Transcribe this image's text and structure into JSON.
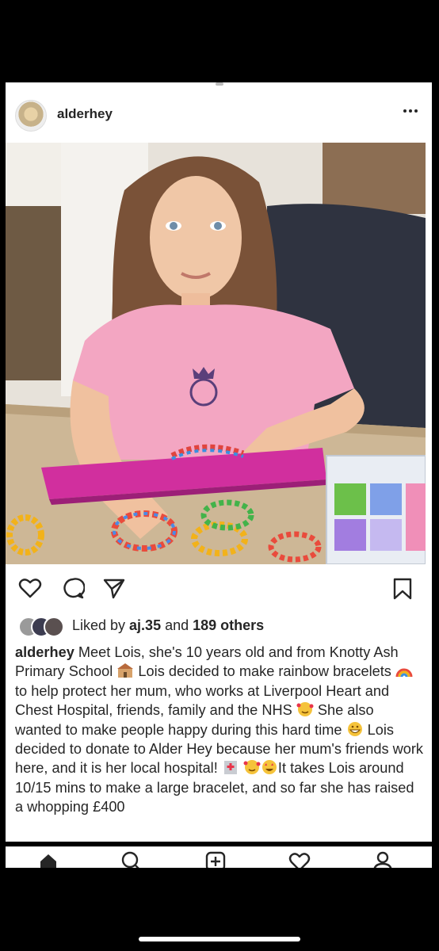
{
  "post": {
    "username": "alderhey",
    "more_icon": "more-horizontal-icon"
  },
  "actions": {
    "icons": [
      "heart-icon",
      "comment-icon",
      "share-icon",
      "bookmark-icon"
    ]
  },
  "likes": {
    "prefix": "Liked by ",
    "user": "aj.35",
    "middle": " and ",
    "others": "189 others"
  },
  "caption": {
    "username": "alderhey",
    "line1": " Meet Lois, she's 10 years old and from Knotty Ash Primary School ",
    "line2": " Lois decided to make rainbow bracelets ",
    "line3": " to help protect her mum, who works at Liverpool Heart and Chest Hospital, friends, family and the NHS ",
    "line4": " She also wanted to make people happy during this hard time ",
    "line5": " Lois decided to donate to Alder Hey because her mum's friends work here, and it is her local hospital! ",
    "line6": "It takes Lois around 10/15 mins to make a large bracelet, and so far she has raised a whopping £400"
  },
  "tabbar": {
    "icons": [
      "home-icon",
      "search-icon",
      "add-post-icon",
      "activity-heart-icon",
      "profile-icon"
    ]
  },
  "colors": {
    "text": "#262626",
    "background": "#000000",
    "card": "#ffffff"
  }
}
